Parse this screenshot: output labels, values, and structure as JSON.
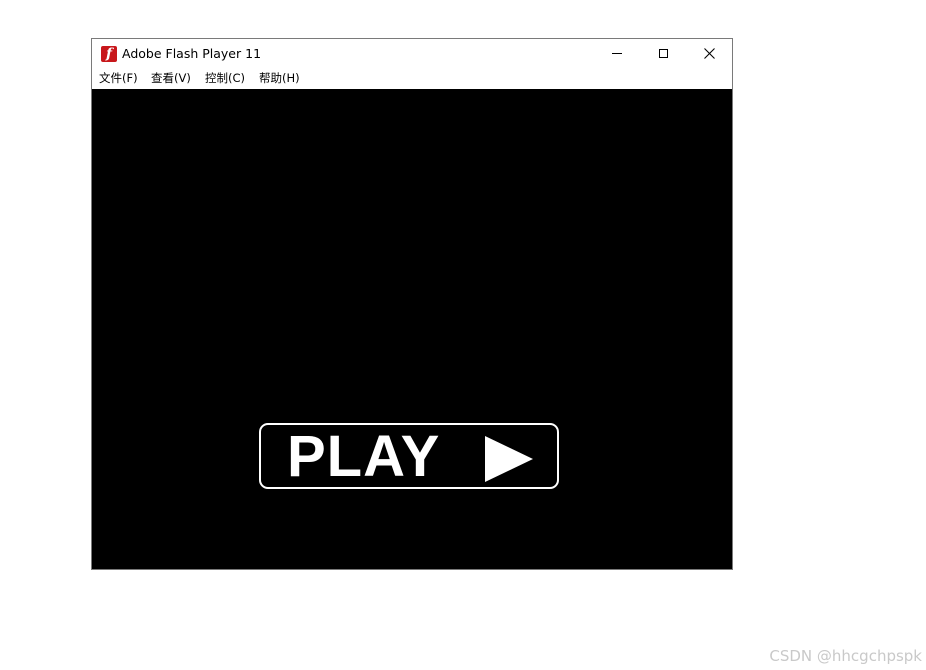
{
  "window": {
    "title": "Adobe Flash Player 11",
    "icon": "flash-player-icon",
    "icon_glyph": "f",
    "icon_color": "#c8171b",
    "controls": [
      "minimize-icon",
      "maximize-icon",
      "close-icon"
    ]
  },
  "menu": {
    "items": [
      {
        "label": "文件(F)"
      },
      {
        "label": "查看(V)"
      },
      {
        "label": "控制(C)"
      },
      {
        "label": "帮助(H)"
      }
    ]
  },
  "stage": {
    "background": "#000000",
    "play_button": {
      "label": "PLAY",
      "icon": "play-triangle-icon",
      "color": "#ffffff"
    }
  },
  "watermark": {
    "text": "CSDN @hhcgchpspk"
  }
}
